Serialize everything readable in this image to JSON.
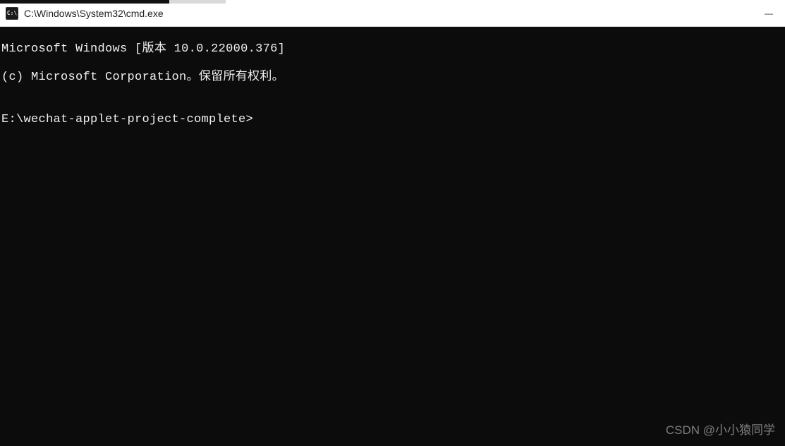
{
  "window": {
    "title": "C:\\Windows\\System32\\cmd.exe",
    "icon_label": "C:\\"
  },
  "controls": {
    "minimize": "—"
  },
  "terminal": {
    "line1": "Microsoft Windows [版本 10.0.22000.376]",
    "line2": "(c) Microsoft Corporation。保留所有权利。",
    "blank": "",
    "prompt": "E:\\wechat-applet-project-complete>"
  },
  "watermark": "CSDN @小小猿同学"
}
